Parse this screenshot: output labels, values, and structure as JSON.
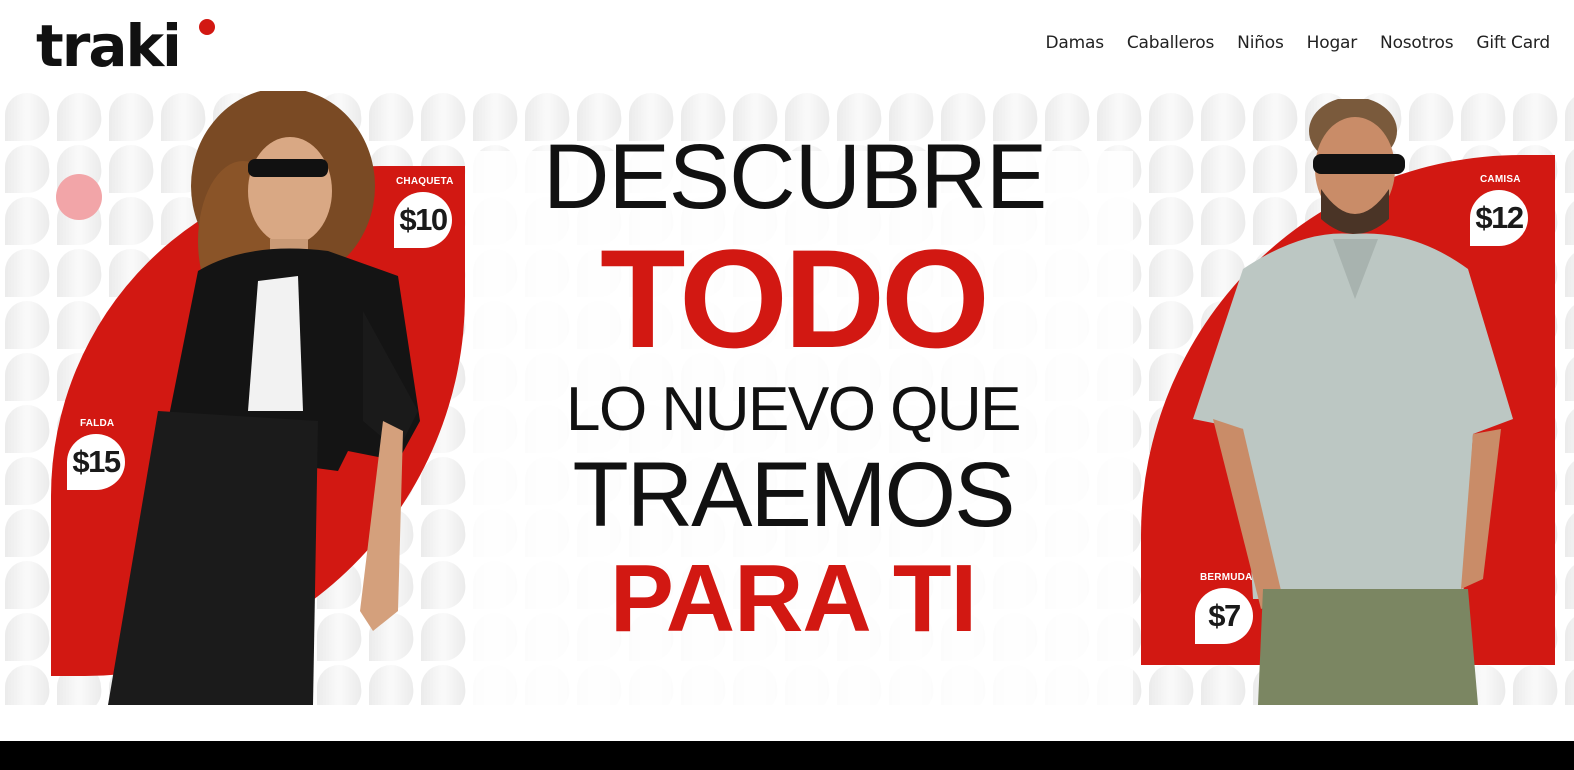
{
  "header": {
    "logo_text": "traki",
    "logo_icon": "traki-logo-icon",
    "nav": [
      {
        "label": "Damas"
      },
      {
        "label": "Caballeros"
      },
      {
        "label": "Niños"
      },
      {
        "label": "Hogar"
      },
      {
        "label": "Nosotros"
      },
      {
        "label": "Gift Card"
      }
    ]
  },
  "hero": {
    "headline": {
      "line1": "DESCUBRE",
      "line2": "TODO",
      "line3": "LO NUEVO QUE",
      "line4": "TRAEMOS",
      "line5": "PARA TI"
    },
    "left_model": {
      "tags": [
        {
          "label": "CHAQUETA",
          "price": "$10"
        },
        {
          "label": "FALDA",
          "price": "$15"
        }
      ]
    },
    "right_model": {
      "tags": [
        {
          "label": "CAMISA",
          "price": "$12"
        },
        {
          "label": "BERMUDA",
          "price": "$7"
        }
      ]
    }
  },
  "colors": {
    "brand_red": "#d21812",
    "text_dark": "#111111",
    "footer_bar": "#000000"
  }
}
